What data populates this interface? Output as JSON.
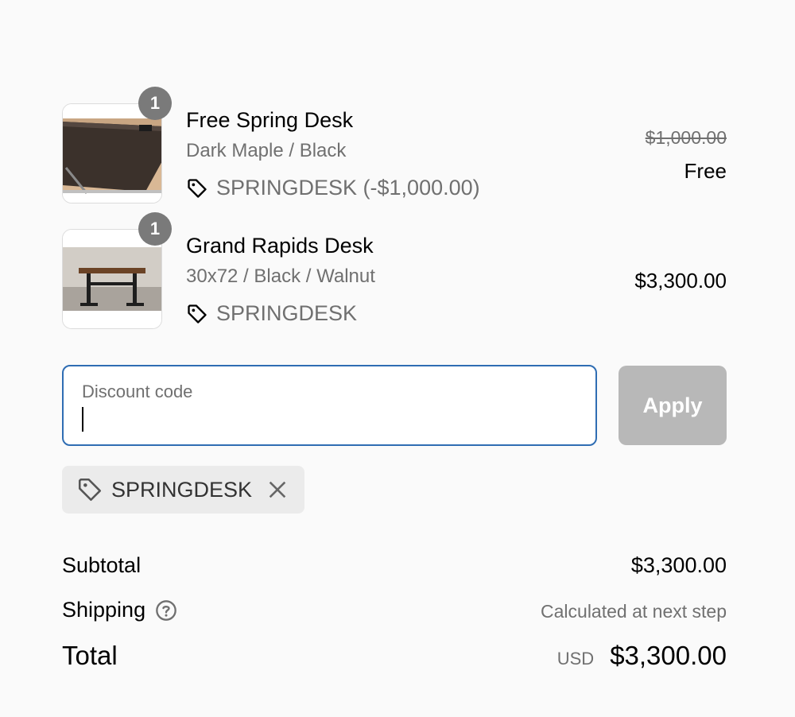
{
  "items": [
    {
      "quantity": "1",
      "name": "Free Spring Desk",
      "variant": "Dark Maple / Black",
      "discount": "SPRINGDESK (-$1,000.00)",
      "original_price": "$1,000.00",
      "price": "Free",
      "thumb_icon": "desk-dark-top-photo"
    },
    {
      "quantity": "1",
      "name": "Grand Rapids Desk",
      "variant": "30x72 / Black / Walnut",
      "discount": "SPRINGDESK",
      "price": "$3,300.00",
      "thumb_icon": "desk-walnut-photo"
    }
  ],
  "discount_field": {
    "placeholder": "Discount code",
    "value": ""
  },
  "apply_button": {
    "label": "Apply"
  },
  "applied_code": {
    "label": "SPRINGDESK"
  },
  "summary": {
    "subtotal_label": "Subtotal",
    "subtotal_value": "$3,300.00",
    "shipping_label": "Shipping",
    "shipping_value": "Calculated at next step",
    "total_label": "Total",
    "currency": "USD",
    "total_value": "$3,300.00"
  },
  "colors": {
    "focus_border": "#2f6db3",
    "apply_disabled": "#b8b8b8",
    "muted_text": "#707070"
  }
}
